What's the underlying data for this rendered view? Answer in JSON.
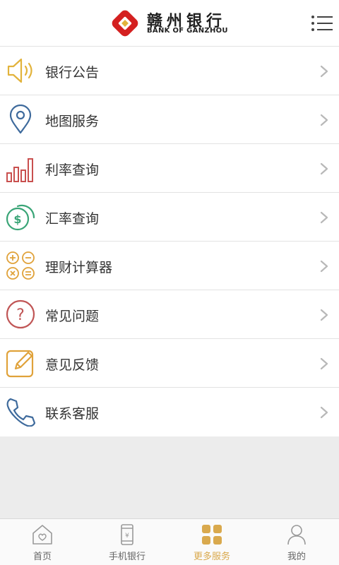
{
  "header": {
    "logo_cn": "赣州银行",
    "logo_en": "BANK OF GANZHOU",
    "menu_icon": "list-menu-icon"
  },
  "services": [
    {
      "label": "银行公告",
      "icon": "speaker-icon",
      "color": "#e2b33c"
    },
    {
      "label": "地图服务",
      "icon": "map-pin-icon",
      "color": "#3e6a9c"
    },
    {
      "label": "利率查询",
      "icon": "bar-chart-icon",
      "color": "#c9504f"
    },
    {
      "label": "汇率查询",
      "icon": "currency-coin-icon",
      "color": "#3aa577"
    },
    {
      "label": "理财计算器",
      "icon": "calculator-icon",
      "color": "#e0a23a"
    },
    {
      "label": "常见问题",
      "icon": "question-icon",
      "color": "#c05555"
    },
    {
      "label": "意见反馈",
      "icon": "feedback-edit-icon",
      "color": "#e0a23a"
    },
    {
      "label": "联系客服",
      "icon": "phone-icon",
      "color": "#3e6a9c"
    }
  ],
  "tabs": [
    {
      "label": "首页",
      "icon": "home-heart-icon",
      "active": false
    },
    {
      "label": "手机银行",
      "icon": "mobile-bank-icon",
      "active": false
    },
    {
      "label": "更多服务",
      "icon": "grid-icon",
      "active": true
    },
    {
      "label": "我的",
      "icon": "person-icon",
      "active": false
    }
  ],
  "colors": {
    "brand_red": "#d42020",
    "active_tab": "#d9a94d",
    "inactive_tab": "#999999"
  }
}
